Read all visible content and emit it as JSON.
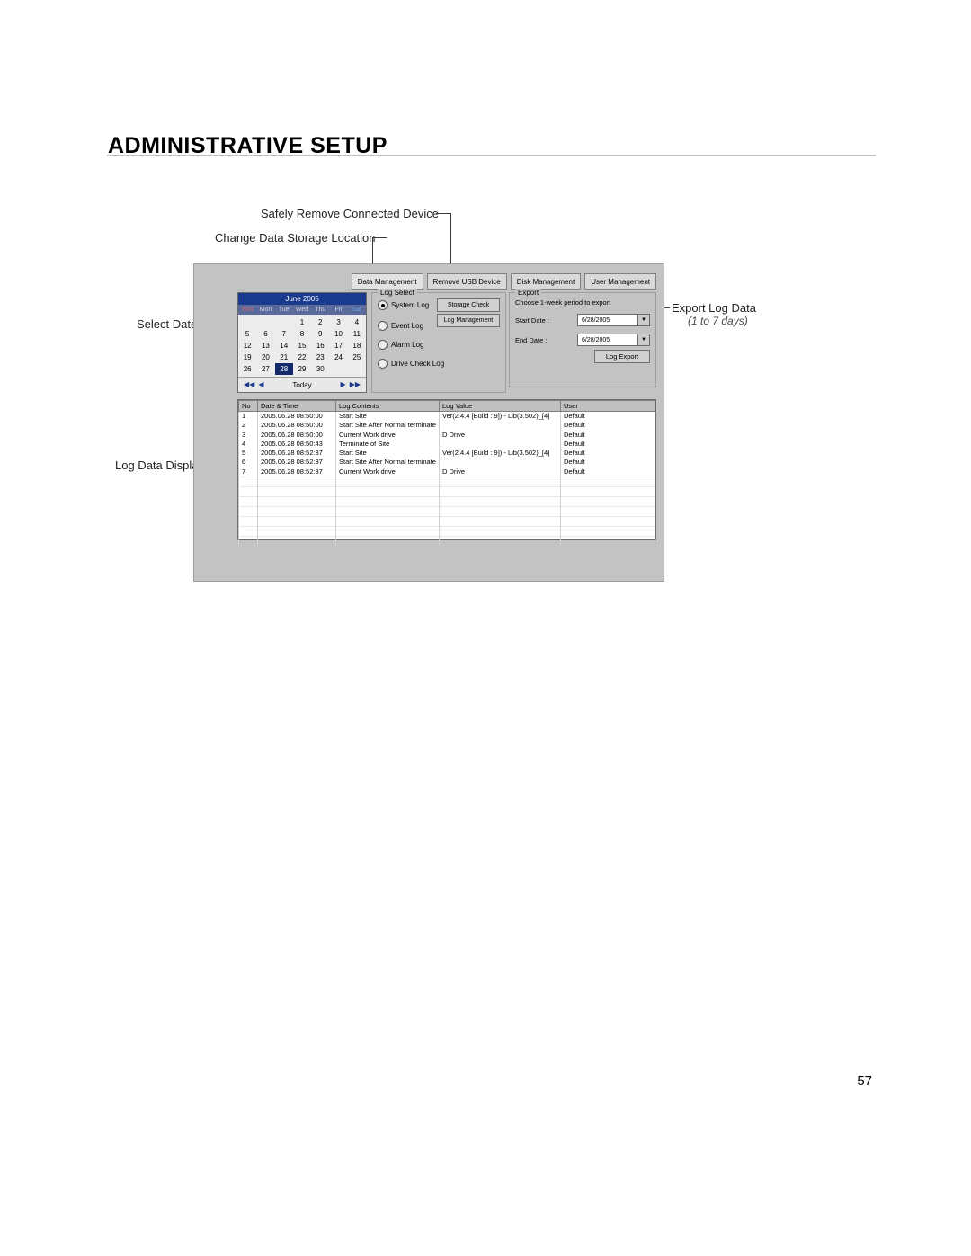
{
  "page": {
    "title": "ADMINISTRATIVE SETUP",
    "number": "57"
  },
  "annotations": {
    "safely_remove": "Safely Remove Connected Device",
    "change_storage": "Change Data Storage Location",
    "select_date": "Select Date",
    "log_display": "Log Data Display",
    "export_log": "Export Log Data",
    "export_range": "(1 to 7 days)"
  },
  "tabs": {
    "data_mgmt": "Data Management",
    "remove_usb": "Remove USB Device",
    "disk_mgmt": "Disk Management",
    "user_mgmt": "User Management"
  },
  "calendar": {
    "month": "June 2005",
    "days": [
      "Sun",
      "Mon",
      "Tue",
      "Wed",
      "Thu",
      "Fri",
      "Sat"
    ],
    "weeks": [
      [
        "",
        "",
        "",
        "1",
        "2",
        "3",
        "4"
      ],
      [
        "5",
        "6",
        "7",
        "8",
        "9",
        "10",
        "11"
      ],
      [
        "12",
        "13",
        "14",
        "15",
        "16",
        "17",
        "18"
      ],
      [
        "19",
        "20",
        "21",
        "22",
        "23",
        "24",
        "25"
      ],
      [
        "26",
        "27",
        "28",
        "29",
        "30",
        "",
        ""
      ]
    ],
    "selected": "28",
    "today": "Today"
  },
  "log_select": {
    "title": "Log Select",
    "system": "System Log",
    "event": "Event Log",
    "alarm": "Alarm Log",
    "drive": "Drive Check Log",
    "storage_check": "Storage Check",
    "log_mgmt": "Log Management"
  },
  "export": {
    "title": "Export",
    "instruction": "Choose 1-week period to export",
    "start_label": "Start Date :",
    "end_label": "End Date :",
    "start_value": "6/28/2005",
    "end_value": "6/28/2005",
    "button": "Log Export"
  },
  "table": {
    "headers": {
      "no": "No",
      "dt": "Date & Time",
      "contents": "Log Contents",
      "value": "Log Value",
      "user": "User"
    },
    "rows": [
      {
        "no": "1",
        "dt": "2005.06.28 08:50:00",
        "contents": "Start Site",
        "value": "Ver(2.4.4 [Build : 9]) - Lib(3.502)_[4]",
        "user": "Default"
      },
      {
        "no": "2",
        "dt": "2005.06.28 08:50:00",
        "contents": "Start Site After Normal terminate",
        "value": "",
        "user": "Default"
      },
      {
        "no": "3",
        "dt": "2005.06.28 08:50:00",
        "contents": "Current Work drive",
        "value": "D Drive",
        "user": "Default"
      },
      {
        "no": "4",
        "dt": "2005.06.28 08:50:43",
        "contents": "Terminate of Site",
        "value": "",
        "user": "Default"
      },
      {
        "no": "5",
        "dt": "2005.06.28 08:52:37",
        "contents": "Start Site",
        "value": "Ver(2.4.4 [Build : 9]) - Lib(3.502)_[4]",
        "user": "Default"
      },
      {
        "no": "6",
        "dt": "2005.06.28 08:52:37",
        "contents": "Start Site After Normal terminate",
        "value": "",
        "user": "Default"
      },
      {
        "no": "7",
        "dt": "2005.06.28 08:52:37",
        "contents": "Current Work drive",
        "value": "D Drive",
        "user": "Default"
      }
    ]
  }
}
